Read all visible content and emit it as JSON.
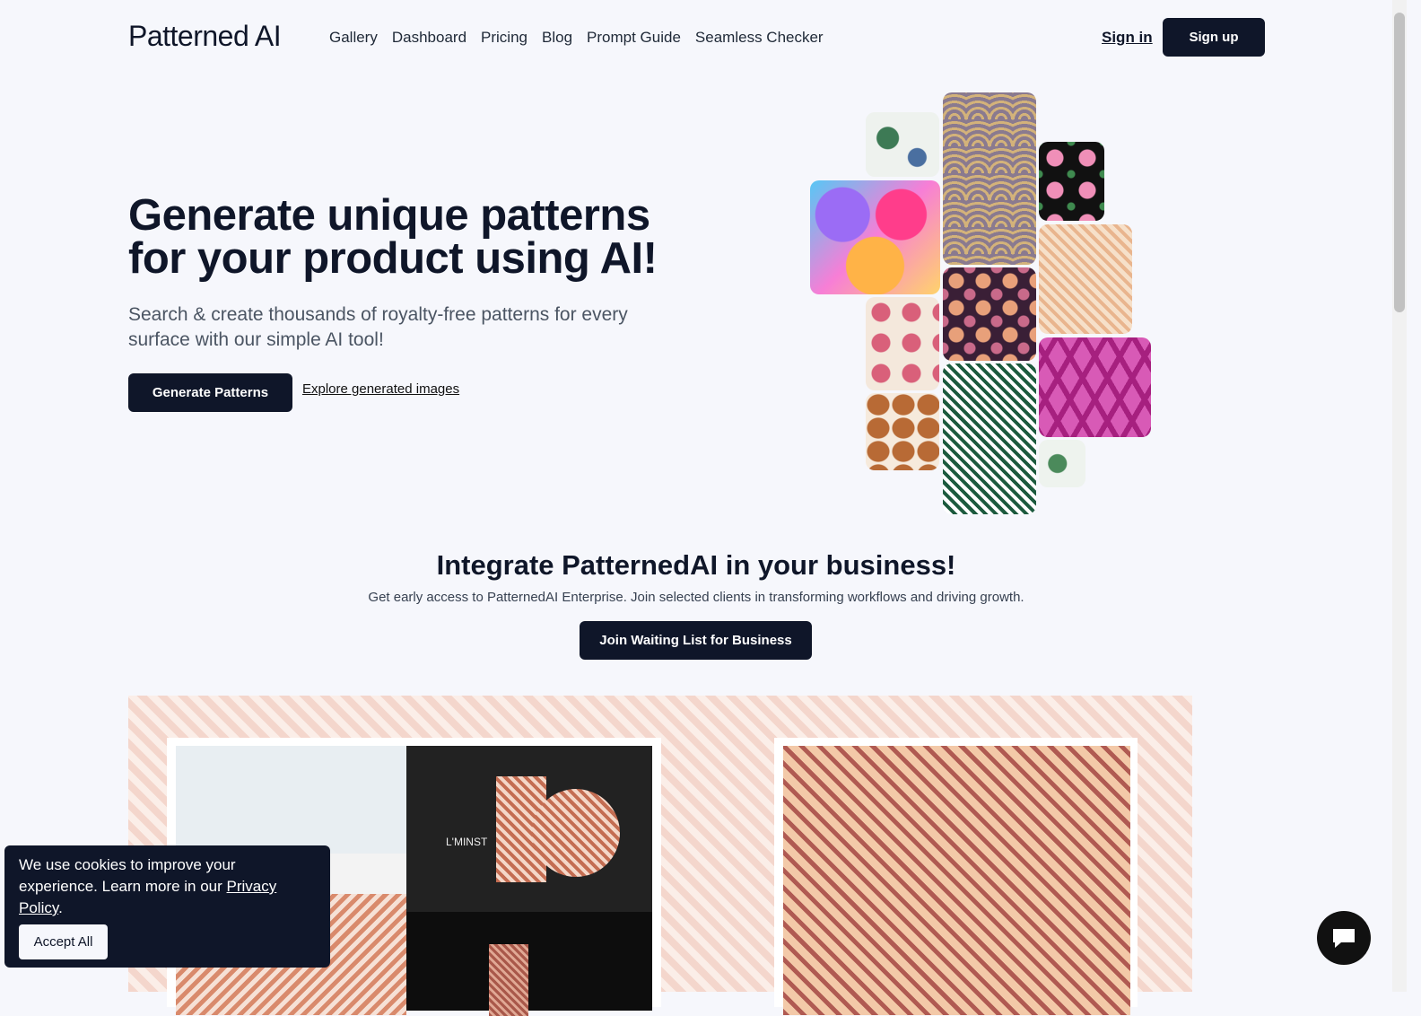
{
  "header": {
    "logo": "Patterned AI",
    "nav": [
      "Gallery",
      "Dashboard",
      "Pricing",
      "Blog",
      "Prompt Guide",
      "Seamless Checker"
    ],
    "sign_in": "Sign in",
    "sign_up": "Sign up"
  },
  "hero": {
    "title": "Generate unique patterns for your product using AI!",
    "subtitle": "Search & create thousands of royalty-free patterns for every surface with our simple AI tool!",
    "primary_button": "Generate Patterns",
    "secondary_link": "Explore generated images"
  },
  "business": {
    "title": "Integrate PatternedAI in your business!",
    "text": "Get early access to PatternedAI Enterprise. Join selected clients in transforming workflows and driving growth.",
    "button": "Join Waiting List for Business"
  },
  "showcase": {
    "brand_text": "L'MINST"
  },
  "cookie": {
    "text": "We use cookies to improve your experience. Learn more in our ",
    "link": "Privacy Policy",
    "end": ".",
    "button": "Accept All"
  },
  "colors": {
    "primary": "#0f1629",
    "background": "#f6f7fc"
  }
}
